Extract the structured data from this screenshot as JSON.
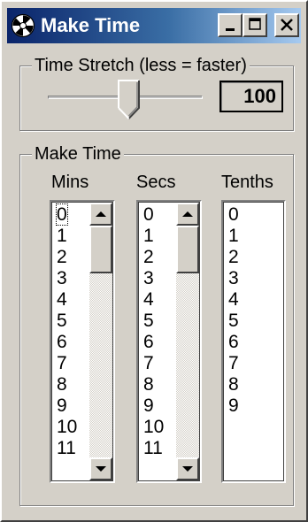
{
  "window": {
    "title": "Make Time",
    "icon": "aperture-icon",
    "buttons": [
      "minimize",
      "maximize",
      "close"
    ]
  },
  "stretch": {
    "legend": "Time Stretch (less = faster)",
    "slider_fraction": 0.5,
    "value": "100"
  },
  "make_time": {
    "legend": "Make Time",
    "columns": [
      {
        "header": "Mins",
        "items": [
          "0",
          "1",
          "2",
          "3",
          "4",
          "5",
          "6",
          "7",
          "8",
          "9",
          "10",
          "11"
        ],
        "focused_index": 0,
        "scrollbar": true
      },
      {
        "header": "Secs",
        "items": [
          "0",
          "1",
          "2",
          "3",
          "4",
          "5",
          "6",
          "7",
          "8",
          "9",
          "10",
          "11"
        ],
        "scrollbar": true
      },
      {
        "header": "Tenths",
        "items": [
          "0",
          "1",
          "2",
          "3",
          "4",
          "5",
          "6",
          "7",
          "8",
          "9"
        ],
        "scrollbar": false
      }
    ]
  },
  "colors": {
    "titlebar_start": "#0a246a",
    "titlebar_end": "#a6caf0",
    "face": "#d4d0c8"
  }
}
